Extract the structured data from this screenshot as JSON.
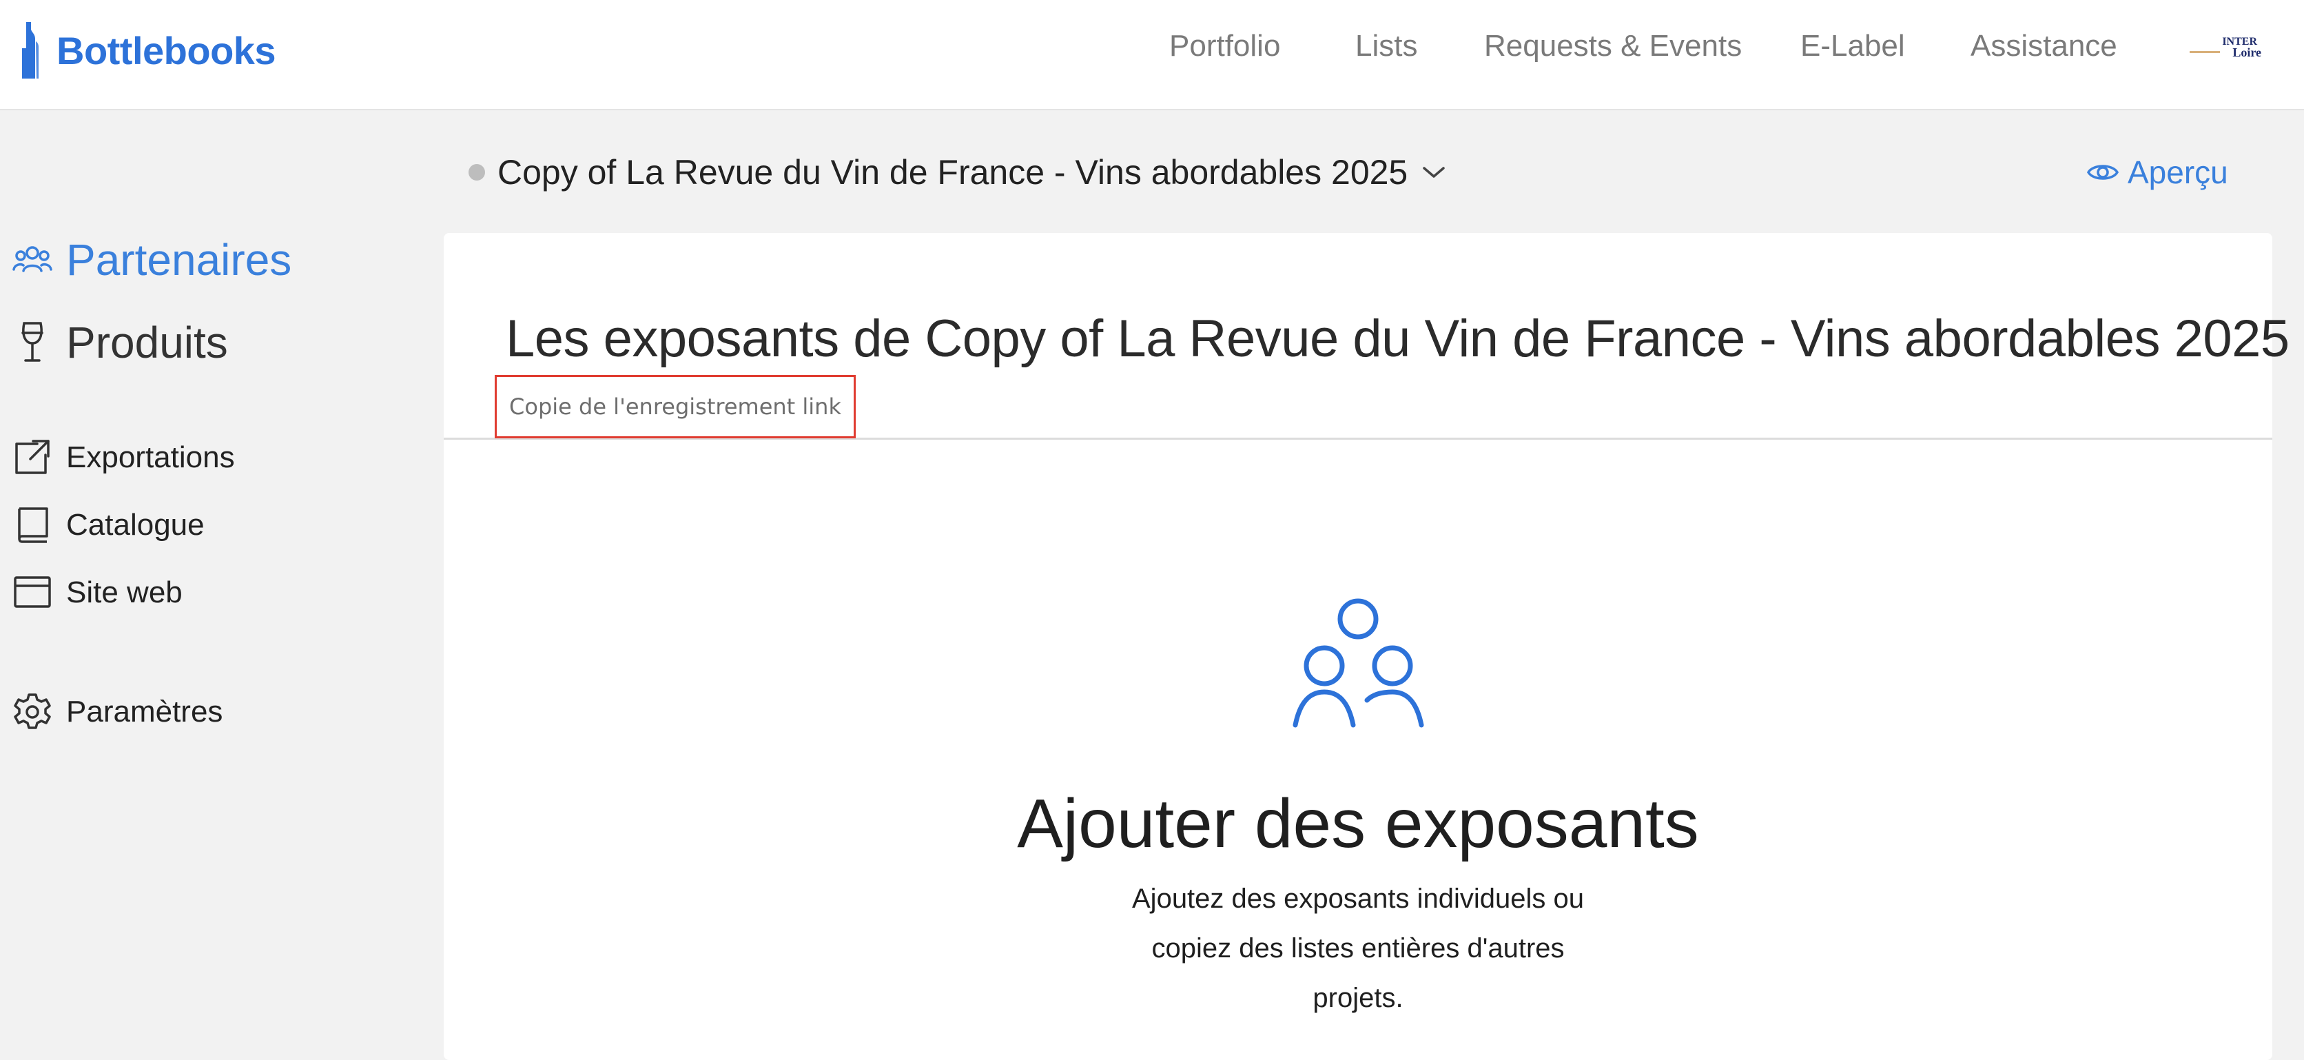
{
  "brand": {
    "name": "Bottlebooks",
    "accent_color": "#2d72d9"
  },
  "nav": {
    "items": [
      {
        "label": "Portfolio"
      },
      {
        "label": "Lists"
      },
      {
        "label": "Requests & Events"
      },
      {
        "label": "E-Label"
      },
      {
        "label": "Assistance"
      }
    ],
    "org_logo": {
      "line1": "INTER",
      "line2": "Loire"
    }
  },
  "sidebar": {
    "primary": [
      {
        "label": "Partenaires",
        "icon": "people-icon",
        "active": true
      },
      {
        "label": "Produits",
        "icon": "wine-glass-icon",
        "active": false
      }
    ],
    "secondary": [
      {
        "label": "Exportations",
        "icon": "external-link-icon"
      },
      {
        "label": "Catalogue",
        "icon": "book-icon"
      },
      {
        "label": "Site web",
        "icon": "browser-window-icon"
      }
    ],
    "settings": {
      "label": "Paramètres",
      "icon": "gear-icon"
    }
  },
  "project": {
    "title": "Copy of La Revue du Vin de France - Vins abordables 2025",
    "preview_label": "Aperçu",
    "status_color": "#bdbdbd"
  },
  "card": {
    "title": "Les exposants de Copy of La Revue du Vin de France - Vins abordables 2025",
    "copy_link_label": "Copie de l'enregistrement link",
    "empty_title": "Ajouter des exposants",
    "empty_description": "Ajoutez des exposants individuels ou copiez des listes entières d'autres projets."
  }
}
